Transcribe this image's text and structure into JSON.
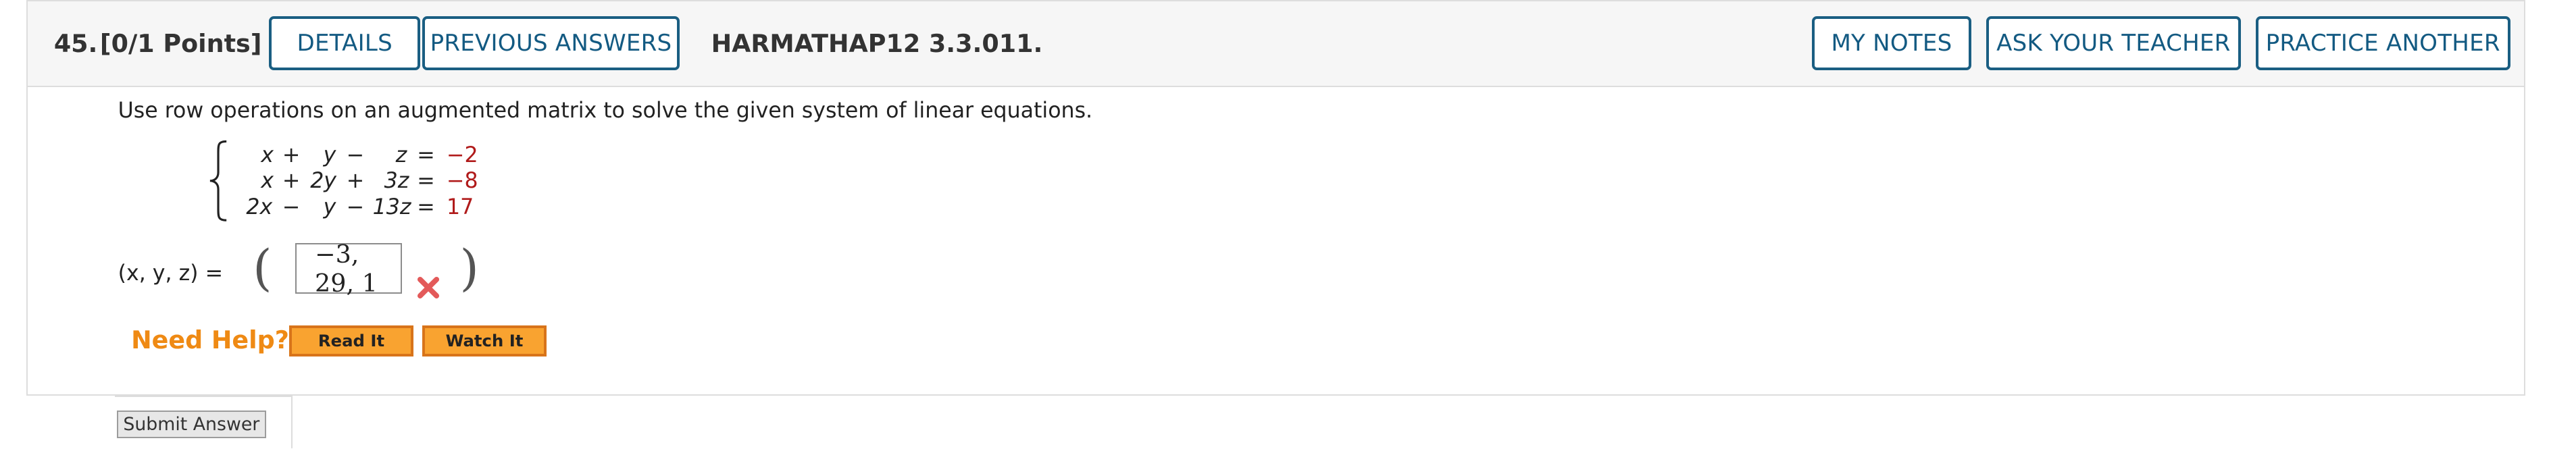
{
  "question": {
    "number": "45.",
    "points": "[0/1 Points]",
    "code": "HARMATHAP12 3.3.011."
  },
  "header_buttons": {
    "details": "DETAILS",
    "previous_answers": "PREVIOUS ANSWERS",
    "my_notes": "MY NOTES",
    "ask_teacher": "ASK YOUR TEACHER",
    "practice_another": "PRACTICE ANOTHER"
  },
  "instruction": "Use row operations on an augmented matrix to solve the given system of linear equations.",
  "system": {
    "eq1": {
      "c1": "x",
      "op1": "+",
      "c2": "y",
      "op2": "−",
      "c3": "z",
      "eq": "=",
      "rhs": "−2"
    },
    "eq2": {
      "c1": "x",
      "op1": "+",
      "c2": "2y",
      "op2": "+",
      "c3": "3z",
      "eq": "=",
      "rhs": "−8"
    },
    "eq3": {
      "c1": "2x",
      "op1": "−",
      "c2": "y",
      "op2": "−",
      "c3": "13z",
      "eq": "=",
      "rhs": "17"
    }
  },
  "answer": {
    "label": "(x, y, z) =",
    "open_paren": "(",
    "value": "−3, 29, 1",
    "close_paren": ")",
    "status_icon": "incorrect-x-icon",
    "status_color": "#e35a5a"
  },
  "help": {
    "label": "Need Help?",
    "read_it": "Read It",
    "watch_it": "Watch It",
    "accent": "#ef8a14"
  },
  "submit": {
    "label": "Submit Answer"
  }
}
